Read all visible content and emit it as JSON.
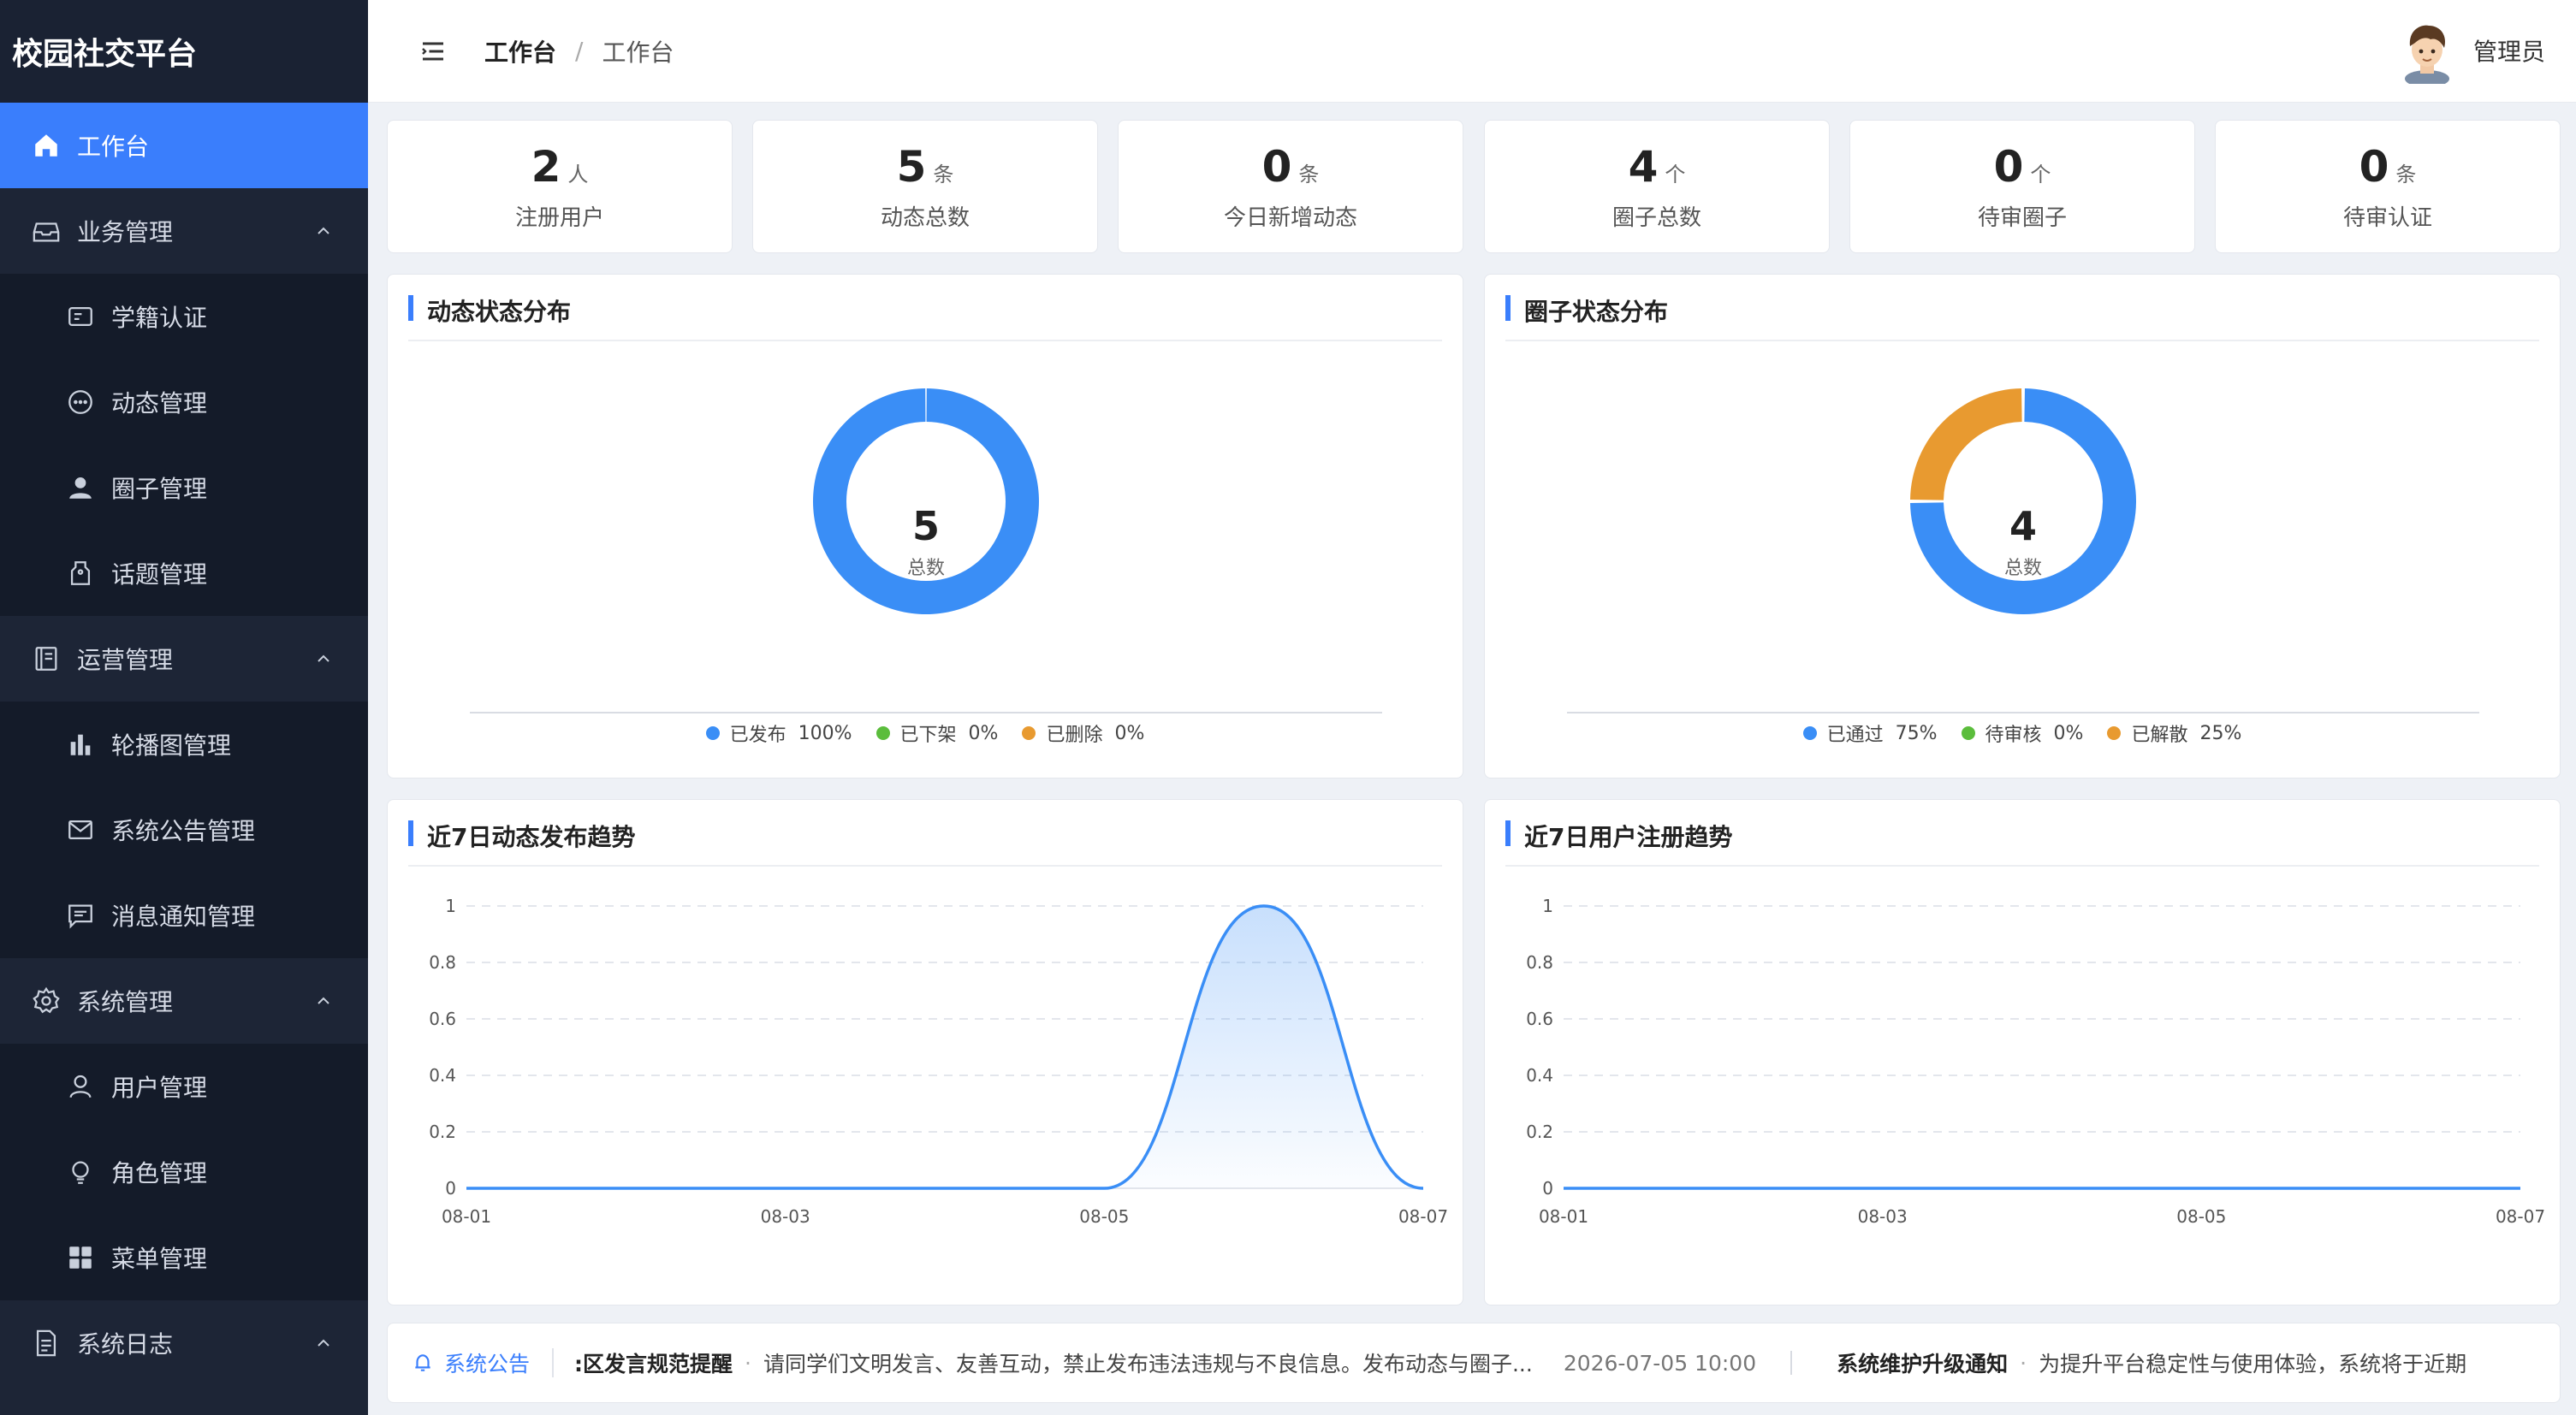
{
  "app": {
    "title": "校园社交平台"
  },
  "sidebar": {
    "items": [
      {
        "label": "工作台",
        "icon": "home-icon"
      },
      {
        "label": "业务管理",
        "icon": "inbox-icon"
      },
      {
        "label": "学籍认证",
        "icon": "id-card-icon"
      },
      {
        "label": "动态管理",
        "icon": "chat-bubble-icon"
      },
      {
        "label": "圈子管理",
        "icon": "user-icon"
      },
      {
        "label": "话题管理",
        "icon": "tag-icon"
      },
      {
        "label": "运营管理",
        "icon": "notebook-icon"
      },
      {
        "label": "轮播图管理",
        "icon": "bar-chart-icon"
      },
      {
        "label": "系统公告管理",
        "icon": "mail-icon"
      },
      {
        "label": "消息通知管理",
        "icon": "message-icon"
      },
      {
        "label": "系统管理",
        "icon": "gear-icon"
      },
      {
        "label": "用户管理",
        "icon": "user-outline-icon"
      },
      {
        "label": "角色管理",
        "icon": "bulb-icon"
      },
      {
        "label": "菜单管理",
        "icon": "grid-icon"
      },
      {
        "label": "系统日志",
        "icon": "document-icon"
      }
    ]
  },
  "header": {
    "breadcrumb_current": "工作台",
    "breadcrumb_sep": "/",
    "breadcrumb_page": "工作台",
    "username": "管理员"
  },
  "stats": [
    {
      "value": "2",
      "unit": "人",
      "label": "注册用户"
    },
    {
      "value": "5",
      "unit": "条",
      "label": "动态总数"
    },
    {
      "value": "0",
      "unit": "条",
      "label": "今日新增动态"
    },
    {
      "value": "4",
      "unit": "个",
      "label": "圈子总数"
    },
    {
      "value": "0",
      "unit": "个",
      "label": "待审圈子"
    },
    {
      "value": "0",
      "unit": "条",
      "label": "待审认证"
    }
  ],
  "panels": {
    "post_status": {
      "title": "动态状态分布",
      "center_value": "5",
      "center_label": "总数",
      "legend": [
        {
          "name": "已发布",
          "pct": "100%"
        },
        {
          "name": "已下架",
          "pct": "0%"
        },
        {
          "name": "已删除",
          "pct": "0%"
        }
      ]
    },
    "circle_status": {
      "title": "圈子状态分布",
      "center_value": "4",
      "center_label": "总数",
      "legend": [
        {
          "name": "已通过",
          "pct": "75%"
        },
        {
          "name": "待审核",
          "pct": "0%"
        },
        {
          "name": "已解散",
          "pct": "25%"
        }
      ]
    },
    "post_trend": {
      "title": "近7日动态发布趋势"
    },
    "user_trend": {
      "title": "近7日用户注册趋势"
    }
  },
  "chart_data": [
    {
      "type": "pie",
      "title": "动态状态分布",
      "categories": [
        "已发布",
        "已下架",
        "已删除"
      ],
      "values": [
        5,
        0,
        0
      ],
      "colors": [
        "#3a8ef6",
        "#5bbd3c",
        "#e89a30"
      ]
    },
    {
      "type": "pie",
      "title": "圈子状态分布",
      "categories": [
        "已通过",
        "待审核",
        "已解散"
      ],
      "values": [
        3,
        0,
        1
      ],
      "colors": [
        "#3a8ef6",
        "#5bbd3c",
        "#e89a30"
      ]
    },
    {
      "type": "area",
      "title": "近7日动态发布趋势",
      "x": [
        "08-01",
        "08-02",
        "08-03",
        "08-04",
        "08-05",
        "08-06",
        "08-07"
      ],
      "x_tick_labels": [
        "08-01",
        "08-03",
        "08-05",
        "08-07"
      ],
      "values": [
        0,
        0,
        0,
        0,
        0,
        1,
        0
      ],
      "ylim": [
        0,
        1
      ],
      "yticks": [
        "0",
        "0.2",
        "0.4",
        "0.6",
        "0.8",
        "1"
      ],
      "color": "#3a8ef6",
      "grid": true
    },
    {
      "type": "line",
      "title": "近7日用户注册趋势",
      "x": [
        "08-01",
        "08-02",
        "08-03",
        "08-04",
        "08-05",
        "08-06",
        "08-07"
      ],
      "x_tick_labels": [
        "08-01",
        "08-03",
        "08-05",
        "08-07"
      ],
      "values": [
        0,
        0,
        0,
        0,
        0,
        0,
        0
      ],
      "ylim": [
        0,
        1
      ],
      "yticks": [
        "0",
        "0.2",
        "0.4",
        "0.6",
        "0.8",
        "1"
      ],
      "color": "#3a8ef6",
      "grid": true
    }
  ],
  "notice": {
    "label": "系统公告",
    "items": [
      {
        "title": ":区发言规范提醒",
        "dot": "·",
        "body": "请同学们文明发言、友善互动，禁止发布违法违规与不良信息。发布动态与圈子...",
        "time": "2026-07-05 10:00"
      },
      {
        "title": "系统维护升级通知",
        "dot": "·",
        "body": "为提升平台稳定性与使用体验，系统将于近期",
        "time": ""
      }
    ]
  }
}
